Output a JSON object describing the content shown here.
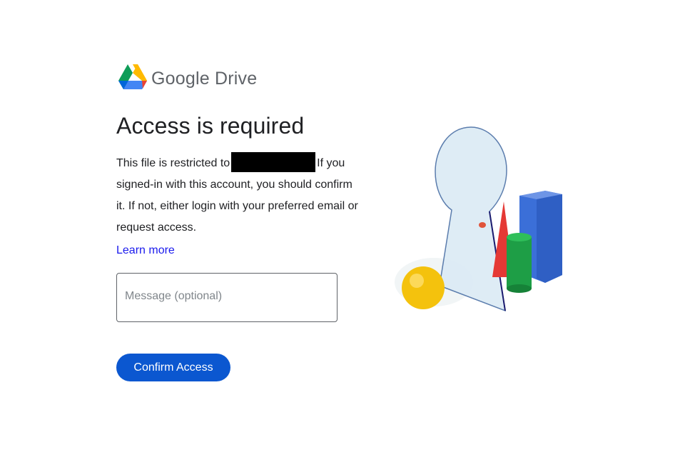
{
  "brand": {
    "logo_icon": "google-drive-logo-icon",
    "google_text": "Google",
    "product_text": "Drive"
  },
  "heading": "Access is required",
  "description": {
    "before_redaction": "This file is restricted to",
    "after_redaction": "If you signed-in with this account, you should confirm it. If not, either login with your preferred email or request access."
  },
  "learn_more": "Learn more",
  "message_field": {
    "placeholder": "Message (optional)",
    "value": ""
  },
  "confirm_button": "Confirm Access",
  "colors": {
    "primary": "#0b57d0",
    "link": "#1a1aed",
    "text": "#202124"
  },
  "illustration": "keyhole-mirror-shapes-illustration"
}
